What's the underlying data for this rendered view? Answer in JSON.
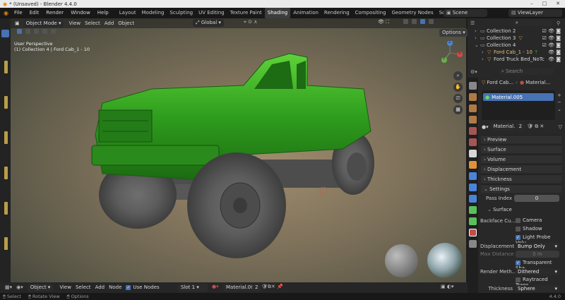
{
  "window": {
    "title": "* (Unsaved) - Blender 4.4.0",
    "minimize": "–",
    "maximize": "□",
    "close": "✕"
  },
  "menu": [
    "File",
    "Edit",
    "Render",
    "Window",
    "Help"
  ],
  "workspaces": [
    "Layout",
    "Modeling",
    "Sculpting",
    "UV Editing",
    "Texture Paint",
    "Shading",
    "Animation",
    "Rendering",
    "Compositing",
    "Geometry Nodes",
    "Scripting"
  ],
  "active_workspace": "Shading",
  "add_workspace": "+",
  "scene": {
    "name": "Scene",
    "view_layer": "ViewLayer"
  },
  "viewport": {
    "mode": "Object Mode",
    "menus": [
      "View",
      "Select",
      "Add",
      "Object"
    ],
    "orientation": "Global",
    "options_label": "Options",
    "info_line1": "User Perspective",
    "info_line2": "(1) Collection 4 | Ford Cab_1 - 10",
    "gizmo": {
      "x": "X",
      "y": "Y",
      "z": "Z"
    }
  },
  "outliner": {
    "search_placeholder": "",
    "items": [
      {
        "label": "Collection 2",
        "indent": 0
      },
      {
        "label": "Collection 3",
        "indent": 0
      },
      {
        "label": "Collection 4",
        "indent": 0
      },
      {
        "label": "Ford Cab_1 - 10",
        "indent": 1
      },
      {
        "label": "Ford Truck Bed_NoTc",
        "indent": 1
      }
    ]
  },
  "properties": {
    "search_placeholder": "Search",
    "breadcrumb_object": "Ford Cab...",
    "breadcrumb_material": "Material...",
    "material_slot": "Material.005",
    "material_name": "Material...",
    "user_count": "2",
    "panels": [
      "Preview",
      "Surface",
      "Volume",
      "Displacement",
      "Thickness",
      "Settings"
    ],
    "pass_index_label": "Pass Index",
    "pass_index_value": "0",
    "surface_sub": "Surface",
    "backface_label": "Backface Cu...",
    "camera_label": "Camera",
    "shadow_label": "Shadow",
    "light_probe_label": "Light Probe Volu...",
    "displacement_label": "Displacement",
    "displacement_value": "Bump Only",
    "max_distance_label": "Max Distance",
    "max_distance_value": "0 m",
    "transparent_shadows_label": "Transparent Sha...",
    "render_method_label": "Render Meth...",
    "render_method_value": "Dithered",
    "raytraced_label": "Raytraced Trans...",
    "thickness_label": "Thickness",
    "thickness_value": "Sphere"
  },
  "shader_header": {
    "object_label": "Object",
    "menus": [
      "View",
      "Select",
      "Add",
      "Node"
    ],
    "use_nodes_label": "Use Nodes",
    "slot": "Slot 1",
    "material": "Material.005",
    "user_count": "2"
  },
  "statusbar": {
    "select": "Select",
    "rotate": "Rotate View",
    "options": "Options",
    "version": "4.4.0"
  },
  "colors": {
    "accent": "#4772b3",
    "truck_green": "#2e9d1d",
    "active_tab": "#3d3d3d",
    "orange_object": "#e0913a"
  }
}
